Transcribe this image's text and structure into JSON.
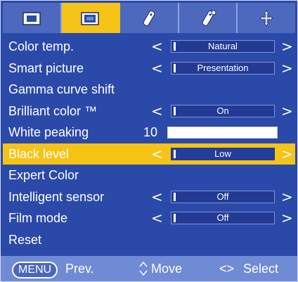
{
  "tabs": [
    {
      "icon": "picture-menu-icon",
      "active": false
    },
    {
      "icon": "screen-menu-icon",
      "active": true
    },
    {
      "icon": "remote-icon",
      "active": false
    },
    {
      "icon": "remote-settings-icon",
      "active": false
    },
    {
      "icon": "options-arrows-icon",
      "active": false
    }
  ],
  "menu": {
    "color_temp": {
      "label": "Color temp.",
      "value": "Natural"
    },
    "smart_picture": {
      "label": "Smart picture",
      "value": "Presentation"
    },
    "gamma": {
      "label": "Gamma curve shift"
    },
    "brilliant": {
      "label": "Brilliant color ™",
      "value": "On"
    },
    "white_peaking": {
      "label": "White peaking",
      "value": "10",
      "level": 1.0
    },
    "black_level": {
      "label": "Black level",
      "value": "Low",
      "selected": true
    },
    "expert": {
      "label": "Expert Color"
    },
    "sensor": {
      "label": "Intelligent sensor",
      "value": "Off"
    },
    "film": {
      "label": "Film mode",
      "value": "Off"
    },
    "reset": {
      "label": "Reset"
    }
  },
  "arrows": {
    "left": "<",
    "right": ">"
  },
  "footer": {
    "menu_key": "MENU",
    "prev": "Prev.",
    "move": "Move",
    "select_keys": "<>",
    "select": "Select"
  },
  "colors": {
    "panel": "#2b49a8",
    "highlight": "#f6c317",
    "footer": "#6f8bd6"
  }
}
